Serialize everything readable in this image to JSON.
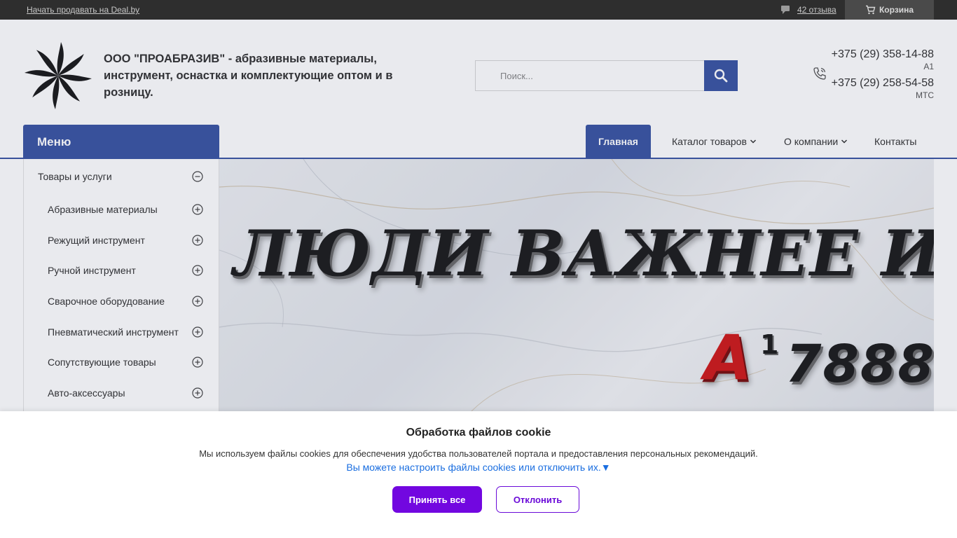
{
  "topbar": {
    "sell_link": "Начать продавать на Deal.by",
    "reviews": "42 отзыва",
    "cart": "Корзина"
  },
  "header": {
    "company_name": "ООО \"ПРОАБРАЗИВ\" - абразивные материалы, инструмент, оснастка и комплектующие оптом и в розницу.",
    "search_placeholder": "Поиск...",
    "phones": [
      {
        "number": "+375 (29) 358-14-88",
        "operator": "A1"
      },
      {
        "number": "+375 (29) 258-54-58",
        "operator": "МТС"
      }
    ]
  },
  "nav": {
    "menu_label": "Меню",
    "items": [
      {
        "label": "Главная",
        "active": true
      },
      {
        "label": "Каталог товаров",
        "dropdown": true
      },
      {
        "label": "О компании",
        "dropdown": true
      },
      {
        "label": "Контакты"
      }
    ],
    "accent_color": "#3a55a3"
  },
  "sidebar": {
    "root": {
      "label": "Товары и услуги",
      "expanded": true
    },
    "items": [
      {
        "label": "Абразивные материалы"
      },
      {
        "label": "Режущий инструмент"
      },
      {
        "label": "Ручной инструмент"
      },
      {
        "label": "Сварочное оборудование"
      },
      {
        "label": "Пневматический инструмент"
      },
      {
        "label": "Сопутствующие товары"
      },
      {
        "label": "Авто-аксессуары"
      }
    ]
  },
  "banner": {
    "slogan": "ЛЮДИ ВАЖНЕЕ ИДЕЙ",
    "brand_letter": "A",
    "brand_sup": "1",
    "brand_number": "7888"
  },
  "cookie": {
    "title": "Обработка файлов cookie",
    "text": "Мы используем файлы cookies для обеспечения удобства пользователей портала и предоставления персональных рекомендаций.",
    "link": "Вы можете настроить файлы cookies или отключить их.▼",
    "accept_label": "Принять все",
    "decline_label": "Отклонить",
    "accent_color": "#7207e0"
  }
}
